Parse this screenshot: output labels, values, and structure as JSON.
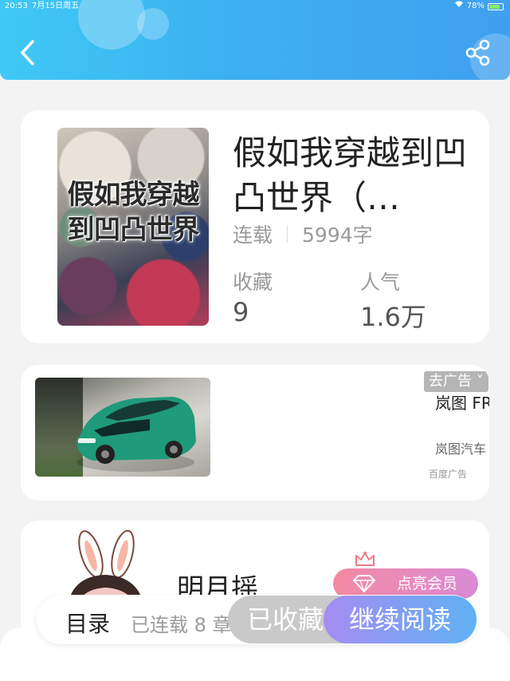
{
  "status_bar": {
    "time": "20:53",
    "date": "7月15日周五",
    "battery": "78%"
  },
  "header": {
    "back_icon": "chevron-left-icon",
    "share_icon": "share-icon",
    "gradient_start": "#3fc9f4",
    "gradient_end": "#40a0ef"
  },
  "book": {
    "cover_text": "假如我穿越到凹凸世界",
    "title": "假如我穿越到凹凸世界（…",
    "status": "连载",
    "word_count": "5994字",
    "favorites_label": "收藏",
    "favorites_value": "9",
    "popularity_label": "人气",
    "popularity_value": "1.6万"
  },
  "ad": {
    "close_label": "去广告 ˅",
    "title": "岚图 FREE",
    "subtitle": "岚图汽车",
    "tag": "百度广告"
  },
  "author": {
    "name": "明月摇",
    "vip_label": "点亮会员"
  },
  "bottom_bar": {
    "toc_label": "目录",
    "serial_info": "已连载 8 章",
    "collected_label": "已收藏",
    "read_label": "继续阅读"
  }
}
